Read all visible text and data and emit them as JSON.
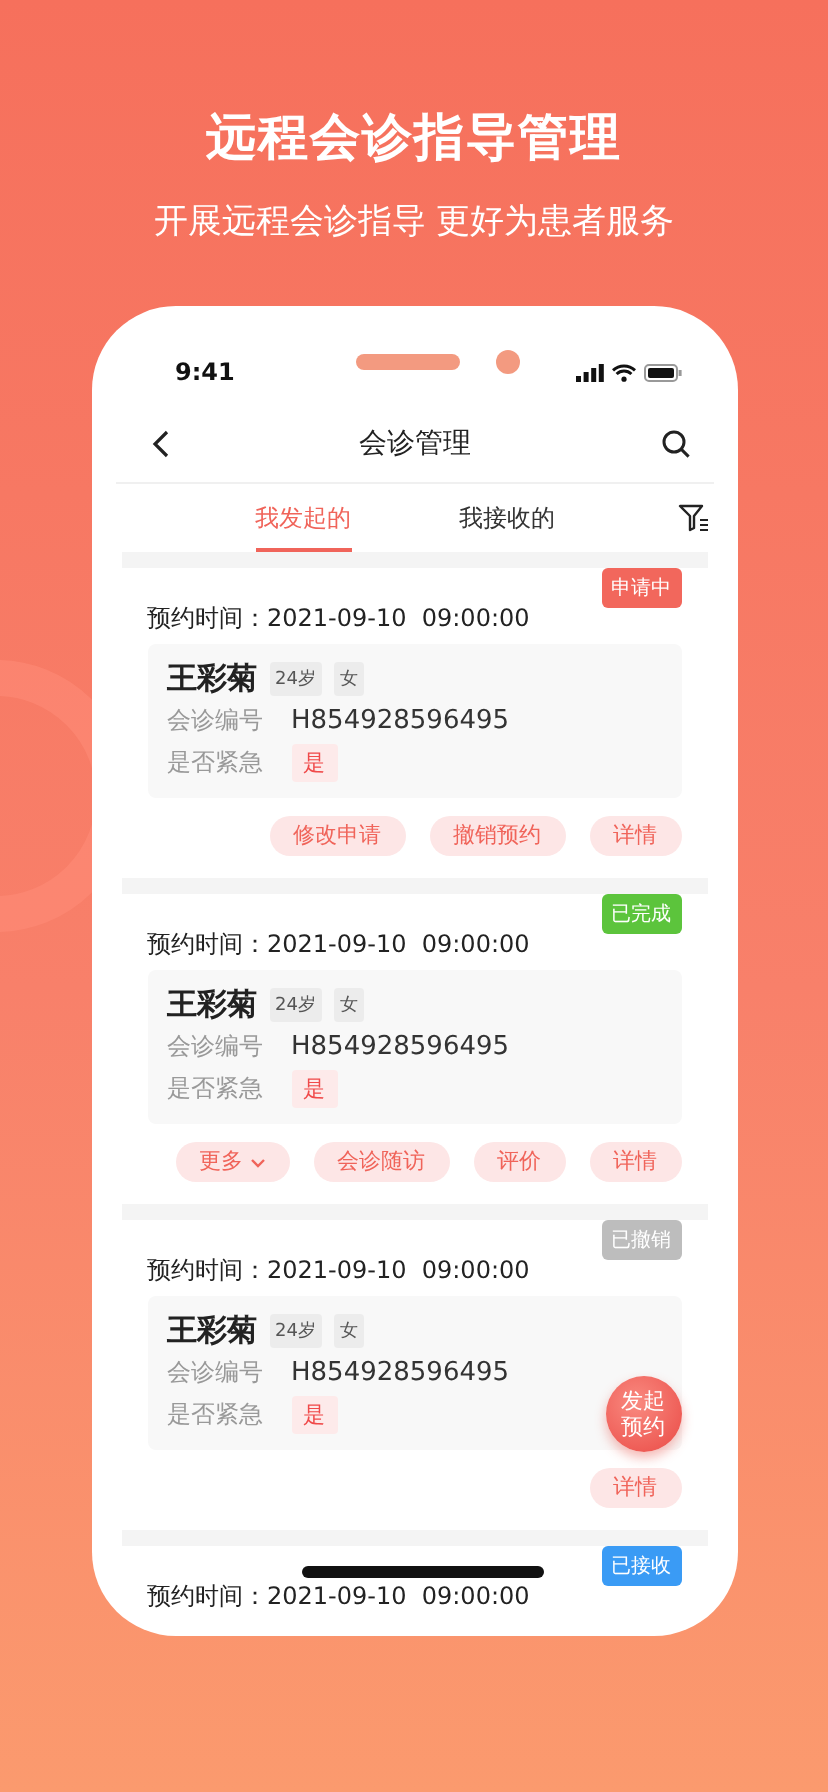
{
  "headline": "远程会诊指导管理",
  "subheadline": "开展远程会诊指导 更好为患者服务",
  "status_bar": {
    "time": "9:41"
  },
  "nav": {
    "title": "会诊管理"
  },
  "tabs": [
    {
      "label": "我发起的",
      "selected": true
    },
    {
      "label": "我接收的",
      "selected": false
    }
  ],
  "cards": [
    {
      "status": {
        "label": "申请中",
        "color": "#f2675c"
      },
      "time_label": "预约时间：",
      "time": "2021-09-10  09:00:00",
      "patient": {
        "name": "王彩菊",
        "age": "24岁",
        "sex": "女"
      },
      "fields": [
        {
          "label": "会诊编号",
          "value": "H854928596495",
          "kind": "text"
        },
        {
          "label": "是否紧急",
          "value": "是",
          "kind": "tag"
        }
      ],
      "actions": [
        {
          "label": "修改申请",
          "kind": "plain"
        },
        {
          "label": "撤销预约",
          "kind": "plain"
        },
        {
          "label": "详情",
          "kind": "plain"
        }
      ]
    },
    {
      "status": {
        "label": "已完成",
        "color": "#5cc43c"
      },
      "time_label": "预约时间：",
      "time": "2021-09-10  09:00:00",
      "patient": {
        "name": "王彩菊",
        "age": "24岁",
        "sex": "女"
      },
      "fields": [
        {
          "label": "会诊编号",
          "value": "H854928596495",
          "kind": "text"
        },
        {
          "label": "是否紧急",
          "value": "是",
          "kind": "tag"
        }
      ],
      "actions": [
        {
          "label": "更多",
          "kind": "dropdown"
        },
        {
          "label": "会诊随访",
          "kind": "plain"
        },
        {
          "label": "评价",
          "kind": "plain"
        },
        {
          "label": "详情",
          "kind": "plain"
        }
      ]
    },
    {
      "status": {
        "label": "已撤销",
        "color": "#bdbdbd"
      },
      "time_label": "预约时间：",
      "time": "2021-09-10  09:00:00",
      "patient": {
        "name": "王彩菊",
        "age": "24岁",
        "sex": "女"
      },
      "fields": [
        {
          "label": "会诊编号",
          "value": "H854928596495",
          "kind": "text"
        },
        {
          "label": "是否紧急",
          "value": "是",
          "kind": "tag"
        }
      ],
      "actions": [
        {
          "label": "详情",
          "kind": "plain"
        }
      ]
    },
    {
      "status": {
        "label": "已接收",
        "color": "#3a9bf5"
      },
      "time_label": "预约时间：",
      "time": "2021-09-10  09:00:00"
    }
  ],
  "fab": {
    "label": "发起预约"
  }
}
